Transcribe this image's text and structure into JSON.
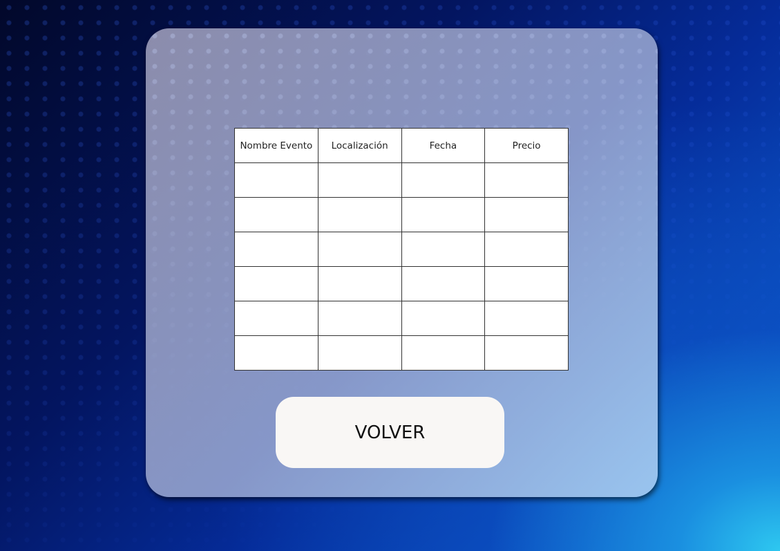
{
  "table": {
    "columns": [
      "Nombre Evento",
      "Localización",
      "Fecha",
      "Precio"
    ],
    "rows": [
      [
        "",
        "",
        "",
        ""
      ],
      [
        "",
        "",
        "",
        ""
      ],
      [
        "",
        "",
        "",
        ""
      ],
      [
        "",
        "",
        "",
        ""
      ],
      [
        "",
        "",
        "",
        ""
      ],
      [
        "",
        "",
        "",
        ""
      ]
    ]
  },
  "buttons": {
    "volver_label": "VOLVER"
  },
  "colors": {
    "panel": "#9aa6cc",
    "button_bg": "#f9f7f5",
    "table_bg": "#ffffff",
    "grid_line": "#333333"
  }
}
